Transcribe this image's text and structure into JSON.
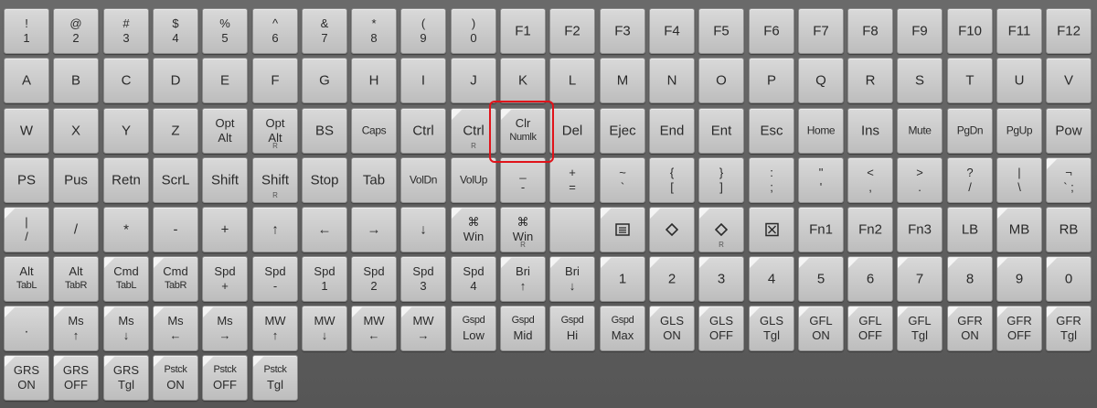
{
  "keyboard": {
    "rows": [
      [
        {
          "top": "!",
          "bot": "1"
        },
        {
          "top": "@",
          "bot": "2"
        },
        {
          "top": "#",
          "bot": "3"
        },
        {
          "top": "$",
          "bot": "4"
        },
        {
          "top": "%",
          "bot": "5"
        },
        {
          "top": "^",
          "bot": "6"
        },
        {
          "top": "&",
          "bot": "7"
        },
        {
          "top": "*",
          "bot": "8"
        },
        {
          "top": "(",
          "bot": "9"
        },
        {
          "top": ")",
          "bot": "0"
        },
        {
          "label": "F1"
        },
        {
          "label": "F2"
        },
        {
          "label": "F3"
        },
        {
          "label": "F4"
        },
        {
          "label": "F5"
        },
        {
          "label": "F6"
        },
        {
          "label": "F7"
        },
        {
          "label": "F8"
        },
        {
          "label": "F9"
        },
        {
          "label": "F10"
        },
        {
          "label": "F11"
        },
        {
          "label": "F12"
        }
      ],
      [
        {
          "label": "A"
        },
        {
          "label": "B"
        },
        {
          "label": "C"
        },
        {
          "label": "D"
        },
        {
          "label": "E"
        },
        {
          "label": "F"
        },
        {
          "label": "G"
        },
        {
          "label": "H"
        },
        {
          "label": "I"
        },
        {
          "label": "J"
        },
        {
          "label": "K"
        },
        {
          "label": "L"
        },
        {
          "label": "M"
        },
        {
          "label": "N"
        },
        {
          "label": "O"
        },
        {
          "label": "P"
        },
        {
          "label": "Q"
        },
        {
          "label": "R"
        },
        {
          "label": "S"
        },
        {
          "label": "T"
        },
        {
          "label": "U"
        },
        {
          "label": "V"
        }
      ],
      [
        {
          "label": "W"
        },
        {
          "label": "X"
        },
        {
          "label": "Y"
        },
        {
          "label": "Z"
        },
        {
          "top": "Opt",
          "bot": "Alt"
        },
        {
          "top": "Opt",
          "bot": "Alt",
          "mod": "R"
        },
        {
          "label": "BS"
        },
        {
          "label": "Caps",
          "small": true
        },
        {
          "label": "Ctrl"
        },
        {
          "label": "Ctrl",
          "mod": "R",
          "tri": true
        },
        {
          "top": "Clr",
          "bot": "Numlk",
          "botSmall": true,
          "tri": true
        },
        {
          "label": "Del"
        },
        {
          "label": "Ejec"
        },
        {
          "label": "End"
        },
        {
          "label": "Ent"
        },
        {
          "label": "Esc"
        },
        {
          "label": "Home",
          "small": true
        },
        {
          "label": "Ins"
        },
        {
          "label": "Mute",
          "small": true
        },
        {
          "label": "PgDn",
          "small": true
        },
        {
          "label": "PgUp",
          "small": true
        },
        {
          "label": "Pow"
        }
      ],
      [
        {
          "label": "PS"
        },
        {
          "label": "Pus"
        },
        {
          "label": "Retn"
        },
        {
          "label": "ScrL"
        },
        {
          "label": "Shift"
        },
        {
          "label": "Shift",
          "mod": "R"
        },
        {
          "label": "Stop"
        },
        {
          "label": "Tab"
        },
        {
          "label": "VolDn",
          "small": true
        },
        {
          "label": "VolUp",
          "small": true
        },
        {
          "top": "_",
          "bot": "-"
        },
        {
          "top": "+",
          "bot": "="
        },
        {
          "top": "~",
          "bot": "`"
        },
        {
          "top": "{",
          "bot": "["
        },
        {
          "top": "}",
          "bot": "]"
        },
        {
          "top": ":",
          "bot": ";"
        },
        {
          "top": "\"",
          "bot": "'"
        },
        {
          "top": "<",
          "bot": ","
        },
        {
          "top": ">",
          "bot": "."
        },
        {
          "top": "?",
          "bot": "/"
        },
        {
          "top": "|",
          "bot": "\\"
        },
        {
          "top": "¬",
          "bot": "` ;",
          "tri": true
        }
      ],
      [
        {
          "top": "|",
          "bot": "/",
          "tri": true
        },
        {
          "label": "/"
        },
        {
          "label": "*"
        },
        {
          "label": "-"
        },
        {
          "label": "+"
        },
        {
          "label": "↑"
        },
        {
          "label": "←"
        },
        {
          "label": "→"
        },
        {
          "label": "↓"
        },
        {
          "top": "⌘",
          "bot": "Win",
          "tri": true
        },
        {
          "top": "⌘",
          "bot": "Win",
          "mod": "R"
        },
        {
          "label": ""
        },
        {
          "icon": "menu-icon",
          "tri": true
        },
        {
          "icon": "diamond-icon",
          "tri": true
        },
        {
          "icon": "diamond-icon",
          "mod": "R",
          "tri": true
        },
        {
          "icon": "boxed-x-icon"
        },
        {
          "label": "Fn1"
        },
        {
          "label": "Fn2"
        },
        {
          "label": "Fn3"
        },
        {
          "label": "LB"
        },
        {
          "label": "MB",
          "tri": true
        },
        {
          "label": "RB"
        }
      ],
      [
        {
          "top": "Alt",
          "bot": "TabL",
          "botSmall": true
        },
        {
          "top": "Alt",
          "bot": "TabR",
          "botSmall": true
        },
        {
          "top": "Cmd",
          "bot": "TabL",
          "botSmall": true,
          "tri": true
        },
        {
          "top": "Cmd",
          "bot": "TabR",
          "botSmall": true,
          "tri": true
        },
        {
          "top": "Spd",
          "bot": "+"
        },
        {
          "top": "Spd",
          "bot": "-"
        },
        {
          "top": "Spd",
          "bot": "1"
        },
        {
          "top": "Spd",
          "bot": "2"
        },
        {
          "top": "Spd",
          "bot": "3"
        },
        {
          "top": "Spd",
          "bot": "4"
        },
        {
          "top": "Bri",
          "bot": "↑",
          "tri": true
        },
        {
          "top": "Bri",
          "bot": "↓",
          "tri": true
        },
        {
          "label": "1",
          "tri": true
        },
        {
          "label": "2",
          "tri": true
        },
        {
          "label": "3",
          "tri": true
        },
        {
          "label": "4",
          "tri": true
        },
        {
          "label": "5",
          "tri": true
        },
        {
          "label": "6",
          "tri": true
        },
        {
          "label": "7",
          "tri": true
        },
        {
          "label": "8",
          "tri": true
        },
        {
          "label": "9",
          "tri": true
        },
        {
          "label": "0",
          "tri": true
        }
      ],
      [
        {
          "label": ".",
          "tri": true
        },
        {
          "top": "Ms",
          "bot": "↑",
          "tri": true
        },
        {
          "top": "Ms",
          "bot": "↓",
          "tri": true
        },
        {
          "top": "Ms",
          "bot": "←",
          "tri": true
        },
        {
          "top": "Ms",
          "bot": "→",
          "tri": true
        },
        {
          "top": "MW",
          "bot": "↑"
        },
        {
          "top": "MW",
          "bot": "↓"
        },
        {
          "top": "MW",
          "bot": "←",
          "tri": true
        },
        {
          "top": "MW",
          "bot": "→",
          "tri": true
        },
        {
          "top": "Gspd",
          "bot": "Low",
          "topSmall": true
        },
        {
          "top": "Gspd",
          "bot": "Mid",
          "topSmall": true
        },
        {
          "top": "Gspd",
          "bot": "Hi",
          "topSmall": true
        },
        {
          "top": "Gspd",
          "bot": "Max",
          "topSmall": true
        },
        {
          "top": "GLS",
          "bot": "ON",
          "tri": true
        },
        {
          "top": "GLS",
          "bot": "OFF",
          "tri": true
        },
        {
          "top": "GLS",
          "bot": "Tgl",
          "tri": true
        },
        {
          "top": "GFL",
          "bot": "ON",
          "tri": true
        },
        {
          "top": "GFL",
          "bot": "OFF",
          "tri": true
        },
        {
          "top": "GFL",
          "bot": "Tgl",
          "tri": true
        },
        {
          "top": "GFR",
          "bot": "ON",
          "tri": true
        },
        {
          "top": "GFR",
          "bot": "OFF",
          "tri": true
        },
        {
          "top": "GFR",
          "bot": "Tgl",
          "tri": true
        }
      ],
      [
        {
          "top": "GRS",
          "bot": "ON",
          "tri": true
        },
        {
          "top": "GRS",
          "bot": "OFF",
          "tri": true
        },
        {
          "top": "GRS",
          "bot": "Tgl",
          "tri": true
        },
        {
          "top": "Pstck",
          "bot": "ON",
          "topSmall": true,
          "tri": true
        },
        {
          "top": "Pstck",
          "bot": "OFF",
          "topSmall": true,
          "tri": true
        },
        {
          "top": "Pstck",
          "bot": "Tgl",
          "topSmall": true,
          "tri": true
        }
      ]
    ]
  },
  "highlight": {
    "color": "#e0131a",
    "key_label": "Clr Numlk"
  }
}
